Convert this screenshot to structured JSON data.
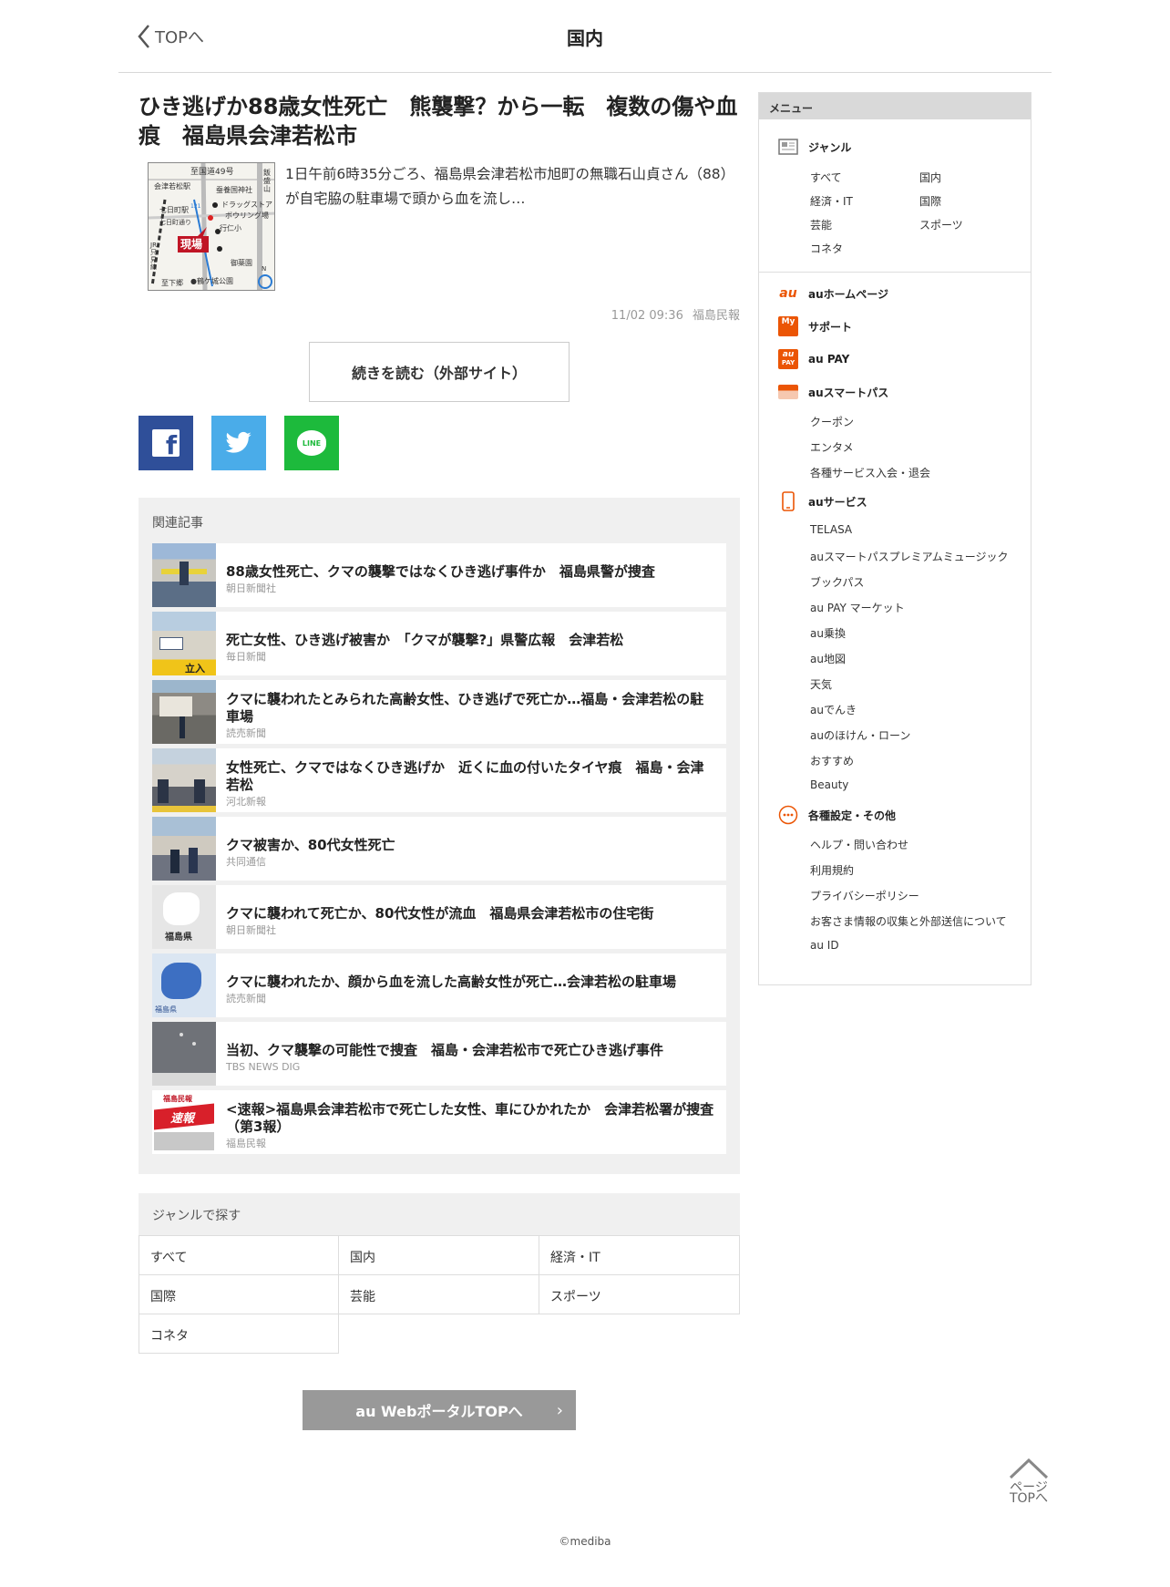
{
  "header": {
    "back_label": "TOPへ",
    "title": "国内"
  },
  "article": {
    "headline": "ひき逃げか88歳女性死亡　熊襲撃？から一転　複数の傷や血痕　福島県会津若松市",
    "summary": "1日午前6時35分ごろ、福島県会津若松市旭町の無職石山貞さん（88）が自宅脇の駐車場で頭から血を流し…",
    "datetime": "11/02 09:36",
    "source": "福島民報",
    "read_more": "続きを読む（外部サイト）",
    "map_labels": {
      "route49": "至国道49号",
      "station": "会津若松駅",
      "shrine": "蚕養国神社",
      "drugstore": "ドラッグストア",
      "bowling": "ボウリング場",
      "school": "行仁小",
      "scene": "現場",
      "park": "御薬園",
      "castle": "●鶴ケ城公園",
      "bottom": "至下郷",
      "nanuka": "七日町駅",
      "nanuka_road": "七日町通り",
      "iide": "飯盛山",
      "route121": "121",
      "jr": "JR只見線",
      "north": "N"
    }
  },
  "share": {
    "facebook": "f",
    "line": "LINE"
  },
  "related": {
    "heading": "関連記事",
    "items": [
      {
        "title": "88歳女性死亡、クマの襲撃ではなくひき逃げ事件か　福島県警が捜査",
        "source": "朝日新聞社"
      },
      {
        "title": "死亡女性、ひき逃げ被害か　「クマが襲撃?」県警広報　会津若松",
        "source": "毎日新聞"
      },
      {
        "title": "クマに襲われたとみられた高齢女性、ひき逃げで死亡か…福島・会津若松の駐車場",
        "source": "読売新聞"
      },
      {
        "title": "女性死亡、クマではなくひき逃げか　近くに血の付いたタイヤ痕　福島・会津若松",
        "source": "河北新報"
      },
      {
        "title": "クマ被害か、80代女性死亡",
        "source": "共同通信"
      },
      {
        "title": "クマに襲われて死亡か、80代女性が流血　福島県会津若松市の住宅街",
        "source": "朝日新聞社"
      },
      {
        "title": "クマに襲われたか、顔から血を流した高齢女性が死亡…会津若松の駐車場",
        "source": "読売新聞"
      },
      {
        "title": "当初、クマ襲撃の可能性で捜査　福島・会津若松市で死亡ひき逃げ事件",
        "source": "TBS NEWS DIG"
      },
      {
        "title": "<速報>福島県会津若松市で死亡した女性、車にひかれたか　会津若松署が捜査（第3報）",
        "source": "福島民報"
      }
    ],
    "thumb_texts": {
      "t2": "立入",
      "t6": "福島県",
      "t7": "福島県",
      "t9a": "福島民報",
      "t9b": "速報"
    }
  },
  "genre": {
    "heading": "ジャンルで探す",
    "cells": [
      "すべて",
      "国内",
      "経済・IT",
      "国際",
      "芸能",
      "スポーツ",
      "コネタ"
    ]
  },
  "portal_button": "au WebポータルTOPへ",
  "page_top": {
    "line1": "ページ",
    "line2": "TOPへ"
  },
  "copyright": "©mediba",
  "sidebar": {
    "heading": "メニュー",
    "genre_label": "ジャンル",
    "genre_links": [
      "すべて",
      "国内",
      "経済・IT",
      "国際",
      "芸能",
      "スポーツ",
      "コネタ"
    ],
    "au_home": "auホームページ",
    "support": "サポート",
    "au_pay": "au PAY",
    "smartpass": "auスマートパス",
    "smartpass_links": [
      "クーポン",
      "エンタメ",
      "各種サービス入会・退会"
    ],
    "au_service": "auサービス",
    "service_links": [
      "TELASA",
      "auスマートパスプレミアムミュージック",
      "ブックパス",
      "au PAY マーケット",
      "au乗換",
      "au地図",
      "天気",
      "auでんき",
      "auのほけん・ローン",
      "おすすめ",
      "Beauty"
    ],
    "settings": "各種設定・その他",
    "settings_links": [
      "ヘルプ・問い合わせ",
      "利用規約",
      "プライバシーポリシー",
      "お客さま情報の収集と外部送信について",
      "au ID"
    ],
    "icon_texts": {
      "au": "au",
      "my": "My",
      "pay_top": "au",
      "pay_bottom": "PAY"
    }
  },
  "colors": {
    "facebook": "#2f4f99",
    "twitter": "#4aace9",
    "line": "#1dba3c",
    "au_orange": "#eb5505",
    "panel_bg": "#f0f0f0"
  }
}
